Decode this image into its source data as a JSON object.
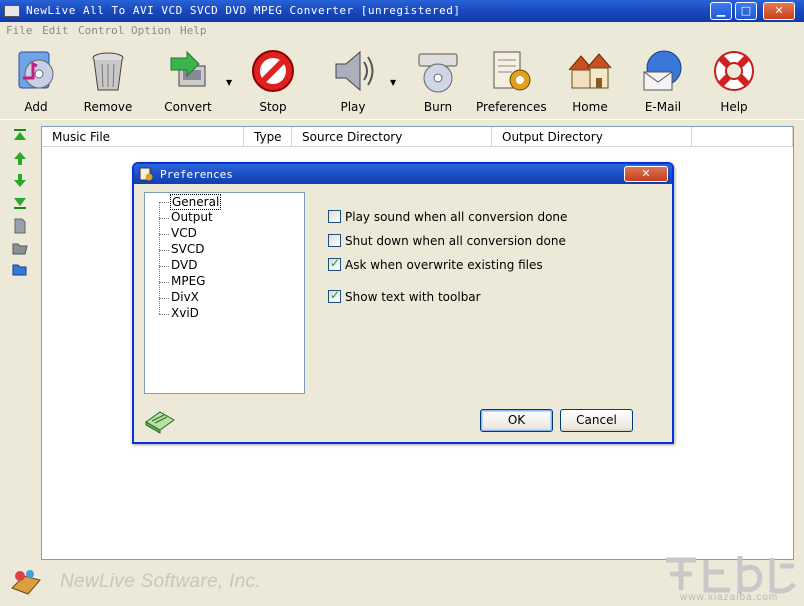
{
  "window": {
    "title": "NewLive All To AVI VCD SVCD DVD MPEG Converter  [unregistered]",
    "controls": {
      "minimize": "▁",
      "maximize": "□",
      "close": "✕"
    }
  },
  "menu": [
    "File",
    "Edit",
    "Control",
    "Option",
    "Help"
  ],
  "toolbar": {
    "add": "Add",
    "remove": "Remove",
    "convert": "Convert",
    "stop": "Stop",
    "play": "Play",
    "burn": "Burn",
    "preferences": "Preferences",
    "home": "Home",
    "email": "E-Mail",
    "help": "Help",
    "dropdown_arrow": "▼"
  },
  "file_list": {
    "columns": [
      "Music File",
      "Type",
      "Source Directory",
      "Output Directory"
    ],
    "rows": []
  },
  "sidebar_icons": [
    "move-top-icon",
    "move-up-icon",
    "move-down-icon",
    "move-bottom-icon",
    "document-icon",
    "folder-icon",
    "open-folder-icon"
  ],
  "status": {
    "brand": "NewLive Software, Inc."
  },
  "preferences_dialog": {
    "title": "Preferences",
    "close": "✕",
    "tree": [
      "General",
      "Output",
      "VCD",
      "SVCD",
      "DVD",
      "MPEG",
      "DivX",
      "XviD"
    ],
    "selected": "General",
    "options": [
      {
        "label": "Play sound when all conversion done",
        "checked": false
      },
      {
        "label": "Shut down when all conversion done",
        "checked": false
      },
      {
        "label": "Ask when overwrite existing files",
        "checked": true
      },
      {
        "label": "Show text with toolbar",
        "checked": true
      }
    ],
    "check_mark": "✓",
    "ok": "OK",
    "cancel": "Cancel"
  },
  "watermark": {
    "text": "www.xiazaiba.com"
  },
  "colors": {
    "titlebar": "#1a4bc0",
    "dialog_border": "#0831d9",
    "background": "#ece9d8"
  }
}
